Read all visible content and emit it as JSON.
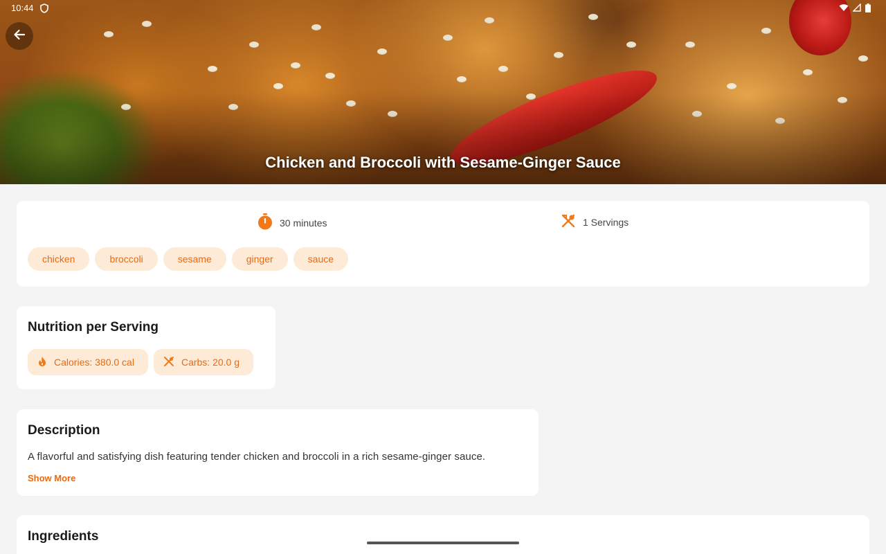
{
  "status_bar": {
    "time": "10:44"
  },
  "hero": {
    "title": "Chicken and Broccoli with Sesame-Ginger Sauce",
    "back_icon": "arrow-left-icon"
  },
  "meta": {
    "time": "30 minutes",
    "time_icon": "timer-icon",
    "servings": "1 Servings",
    "servings_icon": "utensils-icon"
  },
  "tags": [
    "chicken",
    "broccoli",
    "sesame",
    "ginger",
    "sauce"
  ],
  "nutrition": {
    "title": "Nutrition per Serving",
    "calories": "Calories: 380.0 cal",
    "calories_icon": "flame-icon",
    "carbs": "Carbs: 20.0 g",
    "carbs_icon": "utensils-icon"
  },
  "description": {
    "title": "Description",
    "text": "A flavorful and satisfying dish featuring tender chicken and broccoli in a rich sesame-ginger sauce.",
    "show_more": "Show More"
  },
  "ingredients": {
    "title": "Ingredients"
  },
  "colors": {
    "accent": "#e86a10",
    "chip_bg": "#fdebd8",
    "page_bg": "#f4f4f4"
  }
}
